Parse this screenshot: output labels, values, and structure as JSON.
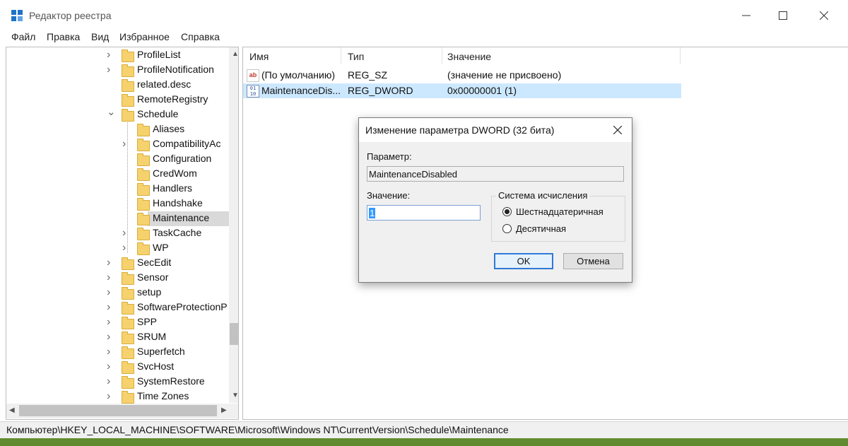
{
  "window": {
    "title": "Редактор реестра"
  },
  "menu": [
    "Файл",
    "Правка",
    "Вид",
    "Избранное",
    "Справка"
  ],
  "tree": {
    "items": [
      {
        "label": "ProfileList",
        "chevron": "right",
        "level": 0
      },
      {
        "label": "ProfileNotification",
        "chevron": "right",
        "level": 0
      },
      {
        "label": "related.desc",
        "chevron": "",
        "level": 0
      },
      {
        "label": "RemoteRegistry",
        "chevron": "",
        "level": 0
      },
      {
        "label": "Schedule",
        "chevron": "down",
        "level": 0
      },
      {
        "label": "Aliases",
        "chevron": "",
        "level": 1
      },
      {
        "label": "CompatibilityAc",
        "chevron": "right",
        "level": 1
      },
      {
        "label": "Configuration",
        "chevron": "",
        "level": 1
      },
      {
        "label": "CredWom",
        "chevron": "",
        "level": 1
      },
      {
        "label": "Handlers",
        "chevron": "",
        "level": 1
      },
      {
        "label": "Handshake",
        "chevron": "",
        "level": 1
      },
      {
        "label": "Maintenance",
        "chevron": "",
        "level": 1,
        "selected": true
      },
      {
        "label": "TaskCache",
        "chevron": "right",
        "level": 1
      },
      {
        "label": "WP",
        "chevron": "right",
        "level": 1
      },
      {
        "label": "SecEdit",
        "chevron": "right",
        "level": 0
      },
      {
        "label": "Sensor",
        "chevron": "right",
        "level": 0
      },
      {
        "label": "setup",
        "chevron": "right",
        "level": 0
      },
      {
        "label": "SoftwareProtectionP",
        "chevron": "right",
        "level": 0
      },
      {
        "label": "SPP",
        "chevron": "right",
        "level": 0
      },
      {
        "label": "SRUM",
        "chevron": "right",
        "level": 0
      },
      {
        "label": "Superfetch",
        "chevron": "right",
        "level": 0
      },
      {
        "label": "SvcHost",
        "chevron": "right",
        "level": 0
      },
      {
        "label": "SystemRestore",
        "chevron": "right",
        "level": 0
      },
      {
        "label": "Time Zones",
        "chevron": "right",
        "level": 0
      }
    ]
  },
  "list": {
    "columns": [
      "Имя",
      "Тип",
      "Значение"
    ],
    "rows": [
      {
        "name": "(По умолчанию)",
        "type": "REG_SZ",
        "value": "(значение не присвоено)",
        "icon": "string-value-icon"
      },
      {
        "name": "MaintenanceDis...",
        "type": "REG_DWORD",
        "value": "0x00000001 (1)",
        "icon": "binary-value-icon",
        "selected": true
      }
    ]
  },
  "status": "Компьютер\\HKEY_LOCAL_MACHINE\\SOFTWARE\\Microsoft\\Windows NT\\CurrentVersion\\Schedule\\Maintenance",
  "dialog": {
    "title": "Изменение параметра DWORD (32 бита)",
    "param_label": "Параметр:",
    "param_value": "MaintenanceDisabled",
    "value_label": "Значение:",
    "value_input": "1",
    "base_group": "Система исчисления",
    "radio_hex": "Шестнадцатеричная",
    "radio_dec": "Десятичная",
    "ok": "OK",
    "cancel": "Отмена"
  },
  "colors": {
    "selection": "#cce8ff",
    "default_button": "#2f7ad6"
  }
}
